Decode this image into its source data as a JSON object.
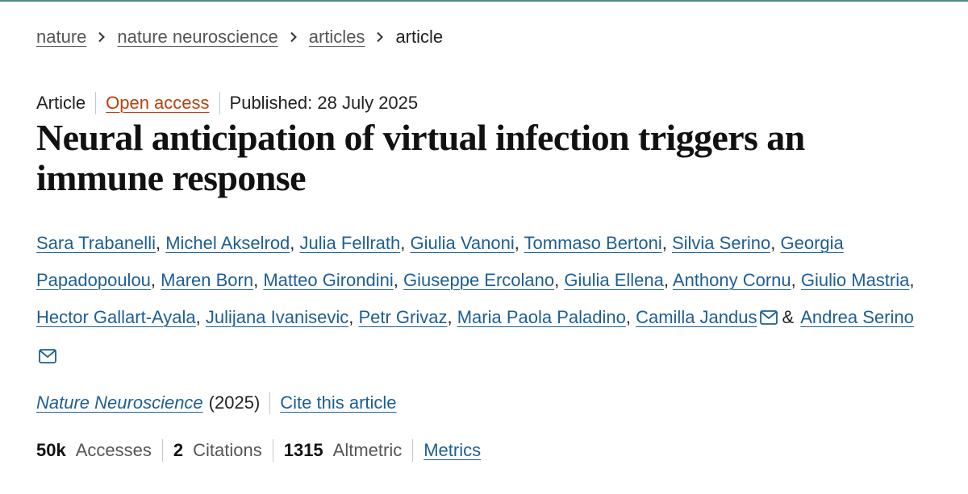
{
  "breadcrumb": {
    "items": [
      "nature",
      "nature neuroscience",
      "articles"
    ],
    "current": "article",
    "separator_icon": "chevron-right-icon"
  },
  "article": {
    "type": "Article",
    "access": "Open access",
    "published": "Published: 28 July 2025",
    "title": "Neural anticipation of virtual infection triggers an immune response",
    "authors": [
      "Sara Trabanelli",
      "Michel Akselrod",
      "Julia Fellrath",
      "Giulia Vanoni",
      "Tommaso Bertoni",
      "Silvia Serino",
      "Georgia Papadopoulou",
      "Maren Born",
      "Matteo Girondini",
      "Giuseppe Ercolano",
      "Giulia Ellena",
      "Anthony Cornu",
      "Giulio Mastria",
      "Hector Gallart-Ayala",
      "Julijana Ivanisevic",
      "Petr Grivaz",
      "Maria Paola Paladino",
      "Camilla Jandus",
      "Andrea Serino"
    ],
    "author_separator": ", ",
    "author_final_separator": "&",
    "corresponding_icon": "mail-icon",
    "journal": "Nature Neuroscience",
    "year": "(2025)",
    "cite_label": "Cite this article"
  },
  "metrics": {
    "accesses_value": "50k",
    "accesses_label": "Accesses",
    "citations_value": "2",
    "citations_label": "Citations",
    "altmetric_value": "1315",
    "altmetric_label": "Altmetric",
    "metrics_link": "Metrics"
  },
  "colors": {
    "link": "#1d5e96",
    "open_access": "#b8410e",
    "top_rule": "#4d8a8a"
  }
}
